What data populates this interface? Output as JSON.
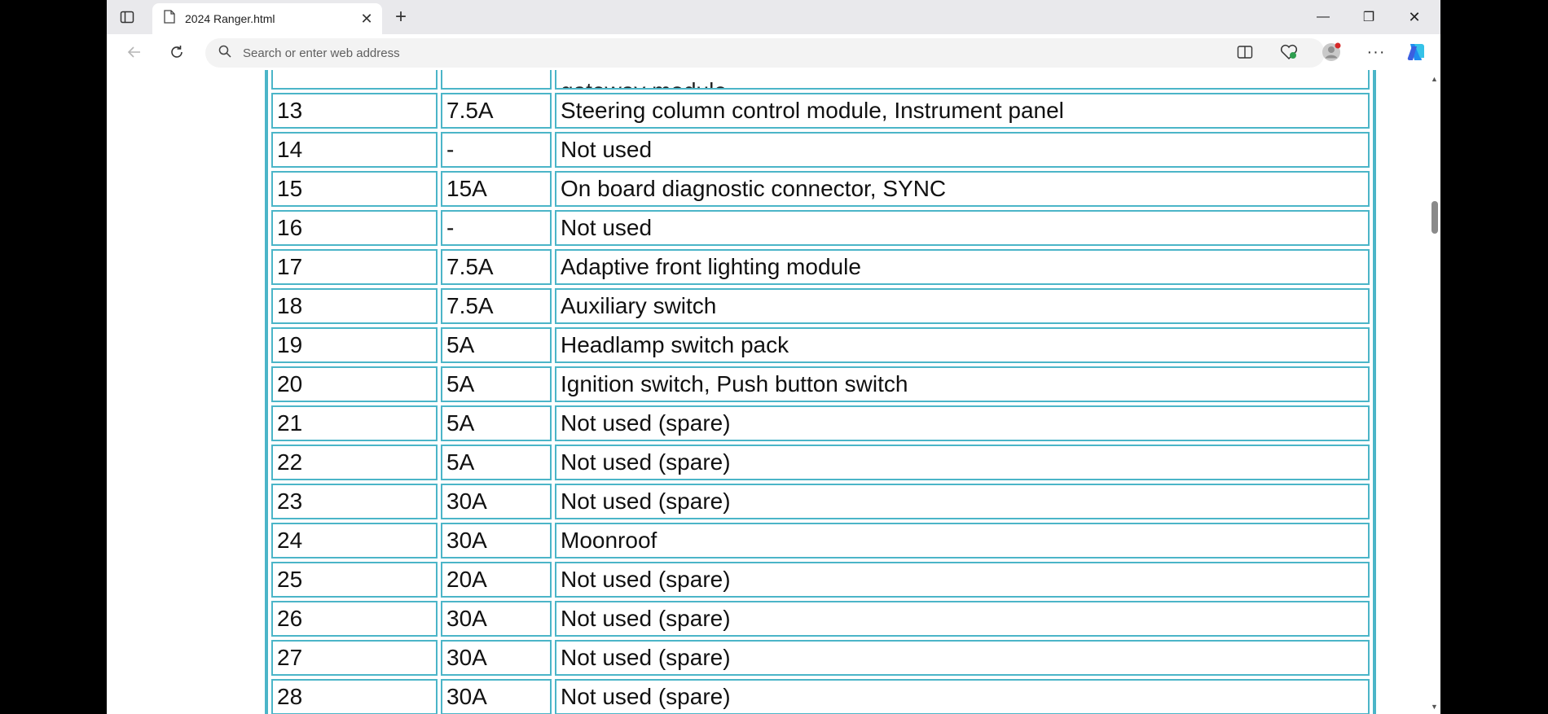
{
  "tab": {
    "title": "2024 Ranger.html",
    "close": "✕"
  },
  "new_tab_label": "+",
  "window": {
    "minimize": "—",
    "restore": "❐",
    "close": "✕"
  },
  "address_bar": {
    "placeholder": "Search or enter web address"
  },
  "fuse_table": {
    "partial_row": {
      "description": "gateway module"
    },
    "rows": [
      {
        "fuse": "13",
        "amp": "7.5A",
        "description": "Steering column control module, Instrument panel"
      },
      {
        "fuse": "14",
        "amp": "-",
        "description": "Not used"
      },
      {
        "fuse": "15",
        "amp": "15A",
        "description": "On board diagnostic connector, SYNC"
      },
      {
        "fuse": "16",
        "amp": "-",
        "description": "Not used"
      },
      {
        "fuse": "17",
        "amp": "7.5A",
        "description": "Adaptive front lighting module"
      },
      {
        "fuse": "18",
        "amp": "7.5A",
        "description": "Auxiliary switch"
      },
      {
        "fuse": "19",
        "amp": "5A",
        "description": "Headlamp switch pack"
      },
      {
        "fuse": "20",
        "amp": "5A",
        "description": "Ignition switch, Push button switch"
      },
      {
        "fuse": "21",
        "amp": "5A",
        "description": "Not used (spare)"
      },
      {
        "fuse": "22",
        "amp": "5A",
        "description": "Not used (spare)"
      },
      {
        "fuse": "23",
        "amp": "30A",
        "description": "Not used (spare)"
      },
      {
        "fuse": "24",
        "amp": "30A",
        "description": "Moonroof"
      },
      {
        "fuse": "25",
        "amp": "20A",
        "description": "Not used (spare)"
      },
      {
        "fuse": "26",
        "amp": "30A",
        "description": "Not used (spare)"
      },
      {
        "fuse": "27",
        "amp": "30A",
        "description": "Not used (spare)"
      },
      {
        "fuse": "28",
        "amp": "30A",
        "description": "Not used (spare)"
      }
    ]
  },
  "scrollbar": {
    "up": "▲",
    "down": "▼",
    "position": 0.2
  },
  "colors": {
    "table_border": "#4bb5c8",
    "copilot": "#1e8cf0"
  }
}
